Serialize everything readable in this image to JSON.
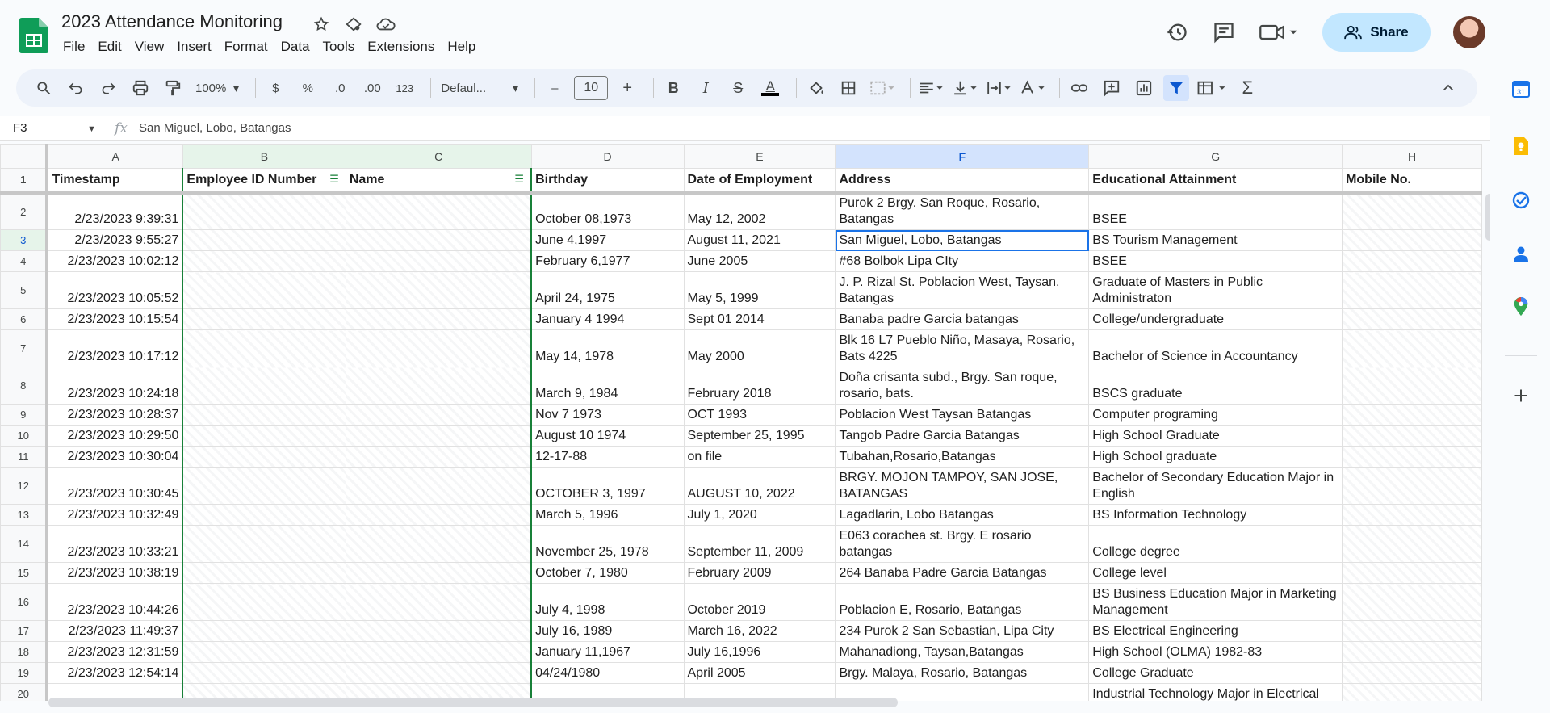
{
  "doc": {
    "title": "2023 Attendance Monitoring"
  },
  "menu": [
    "File",
    "Edit",
    "View",
    "Insert",
    "Format",
    "Data",
    "Tools",
    "Extensions",
    "Help"
  ],
  "share_label": "Share",
  "toolbar": {
    "zoom": "100%",
    "currency": "$",
    "percent": "%",
    "dec_decrease": ".0",
    "dec_increase": ".00",
    "number_format": "123",
    "font": "Defaul...",
    "font_size": "10",
    "minus": "–",
    "plus": "+",
    "bold": "B",
    "italic": "I",
    "strike": "S",
    "text_color": "A"
  },
  "formula_bar": {
    "cell_ref": "F3",
    "content": "San Miguel, Lobo, Batangas"
  },
  "columns": [
    "A",
    "B",
    "C",
    "D",
    "E",
    "F",
    "G",
    "H"
  ],
  "headers": [
    "Timestamp",
    "Employee ID Number",
    "Name",
    "Birthday",
    "Date of Employment",
    "Address",
    "Educational Attainment",
    "Mobile No."
  ],
  "rows": [
    {
      "n": "2",
      "ts": "2/23/2023 9:39:31",
      "bd": "October 08,1973",
      "de": "May 12, 2002",
      "addr": "Purok 2 Brgy. San Roque, Rosario, Batangas",
      "edu": "BSEE"
    },
    {
      "n": "3",
      "ts": "2/23/2023 9:55:27",
      "bd": "June 4,1997",
      "de": "August 11, 2021",
      "addr": "San Miguel, Lobo, Batangas",
      "edu": "BS Tourism Management"
    },
    {
      "n": "4",
      "ts": "2/23/2023 10:02:12",
      "bd": "February 6,1977",
      "de": "June 2005",
      "addr": "#68 Bolbok Lipa CIty",
      "edu": "BSEE"
    },
    {
      "n": "5",
      "ts": "2/23/2023 10:05:52",
      "bd": "April 24, 1975",
      "de": "May 5, 1999",
      "addr": " J. P. Rizal St. Poblacion West, Taysan, Batangas",
      "edu": "Graduate of Masters in Public Administraton"
    },
    {
      "n": "6",
      "ts": "2/23/2023 10:15:54",
      "bd": "January 4 1994",
      "de": "Sept 01 2014",
      "addr": "Banaba padre Garcia batangas",
      "edu": "College/undergraduate"
    },
    {
      "n": "7",
      "ts": "2/23/2023 10:17:12",
      "bd": "May 14, 1978",
      "de": "May 2000",
      "addr": "Blk 16 L7 Pueblo Niño, Masaya, Rosario, Bats 4225",
      "edu": "Bachelor of Science in Accountancy"
    },
    {
      "n": "8",
      "ts": "2/23/2023 10:24:18",
      "bd": "March 9, 1984",
      "de": "February 2018",
      "addr": "Doña crisanta subd., Brgy. San roque, rosario, bats.",
      "edu": "BSCS graduate"
    },
    {
      "n": "9",
      "ts": "2/23/2023 10:28:37",
      "bd": "Nov 7 1973",
      "de": "OCT 1993",
      "addr": "Poblacion West Taysan Batangas",
      "edu": "Computer programing"
    },
    {
      "n": "10",
      "ts": "2/23/2023 10:29:50",
      "bd": "August 10 1974",
      "de": "September 25, 1995",
      "addr": "Tangob Padre Garcia Batangas",
      "edu": "High School Graduate"
    },
    {
      "n": "11",
      "ts": "2/23/2023 10:30:04",
      "bd": "12-17-88",
      "de": "on file",
      "addr": "Tubahan,Rosario,Batangas",
      "edu": "High School graduate"
    },
    {
      "n": "12",
      "ts": "2/23/2023 10:30:45",
      "bd": "OCTOBER 3, 1997",
      "de": "AUGUST 10, 2022",
      "addr": "BRGY. MOJON TAMPOY, SAN JOSE, BATANGAS",
      "edu": "Bachelor of Secondary Education Major in English"
    },
    {
      "n": "13",
      "ts": "2/23/2023 10:32:49",
      "bd": "March 5, 1996",
      "de": "July 1, 2020",
      "addr": "Lagadlarin, Lobo Batangas",
      "edu": "BS Information Technology"
    },
    {
      "n": "14",
      "ts": "2/23/2023 10:33:21",
      "bd": "November 25, 1978",
      "de": "September 11, 2009",
      "addr": "E063 corachea st. Brgy. E rosario batangas",
      "edu": "College degree"
    },
    {
      "n": "15",
      "ts": "2/23/2023 10:38:19",
      "bd": "October 7, 1980",
      "de": "February 2009",
      "addr": "264 Banaba Padre Garcia Batangas",
      "edu": "College level"
    },
    {
      "n": "16",
      "ts": "2/23/2023 10:44:26",
      "bd": "July 4, 1998",
      "de": "October 2019",
      "addr": "Poblacion E, Rosario, Batangas",
      "edu": "BS Business Education Major in Marketing Management"
    },
    {
      "n": "17",
      "ts": "2/23/2023 11:49:37",
      "bd": "July 16, 1989",
      "de": "March 16, 2022",
      "addr": "234 Purok 2 San Sebastian, Lipa City",
      "edu": "BS Electrical Engineering"
    },
    {
      "n": "18",
      "ts": "2/23/2023 12:31:59",
      "bd": "January 11,1967",
      "de": "July 16,1996",
      "addr": "Mahanadiong, Taysan,Batangas",
      "edu": "High School (OLMA) 1982-83"
    },
    {
      "n": "19",
      "ts": "2/23/2023 12:54:14",
      "bd": "04/24/1980",
      "de": "April 2005",
      "addr": "Brgy. Malaya, Rosario, Batangas",
      "edu": "College Graduate"
    },
    {
      "n": "20",
      "ts": "",
      "bd": "",
      "de": "",
      "addr": "",
      "edu": "Industrial Technology Major in Electrical"
    }
  ],
  "colors": {
    "accent": "#1a73e8",
    "share_bg": "#c2e7ff",
    "filter_green": "#188038",
    "sheets_green": "#0f9d58"
  }
}
